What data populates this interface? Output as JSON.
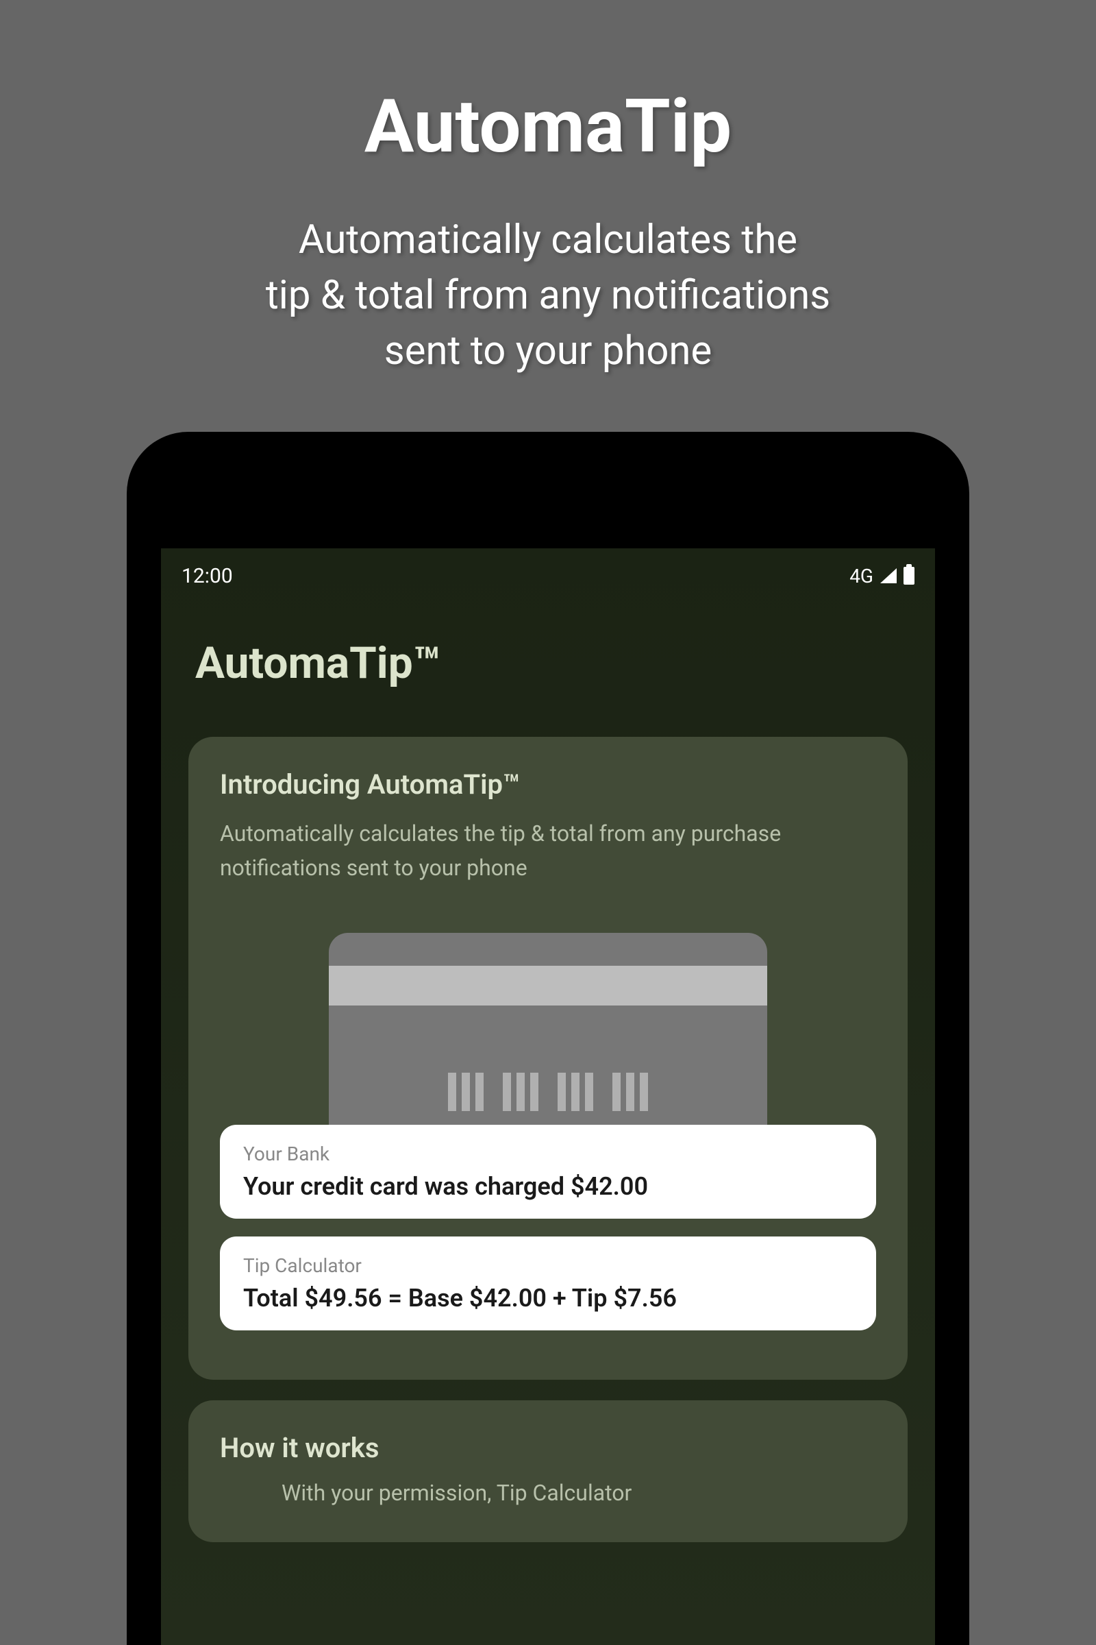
{
  "hero": {
    "title": "AutomaTip",
    "subtitle": "Automatically calculates the\ntip & total from any notifications\nsent to your phone"
  },
  "statusBar": {
    "time": "12:00",
    "network": "4G"
  },
  "app": {
    "title": "AutomaTip™"
  },
  "introCard": {
    "heading": "Introducing AutomaTip™",
    "body": "Automatically calculates the tip & total from any purchase notifications sent to your phone"
  },
  "notif1": {
    "source": "Your Bank",
    "text": "Your credit card was charged $42.00"
  },
  "notif2": {
    "source": "Tip Calculator",
    "text": "Total $49.56 = Base $42.00 + Tip $7.56"
  },
  "howCard": {
    "heading": "How it works",
    "body": "With your permission, Tip Calculator"
  }
}
